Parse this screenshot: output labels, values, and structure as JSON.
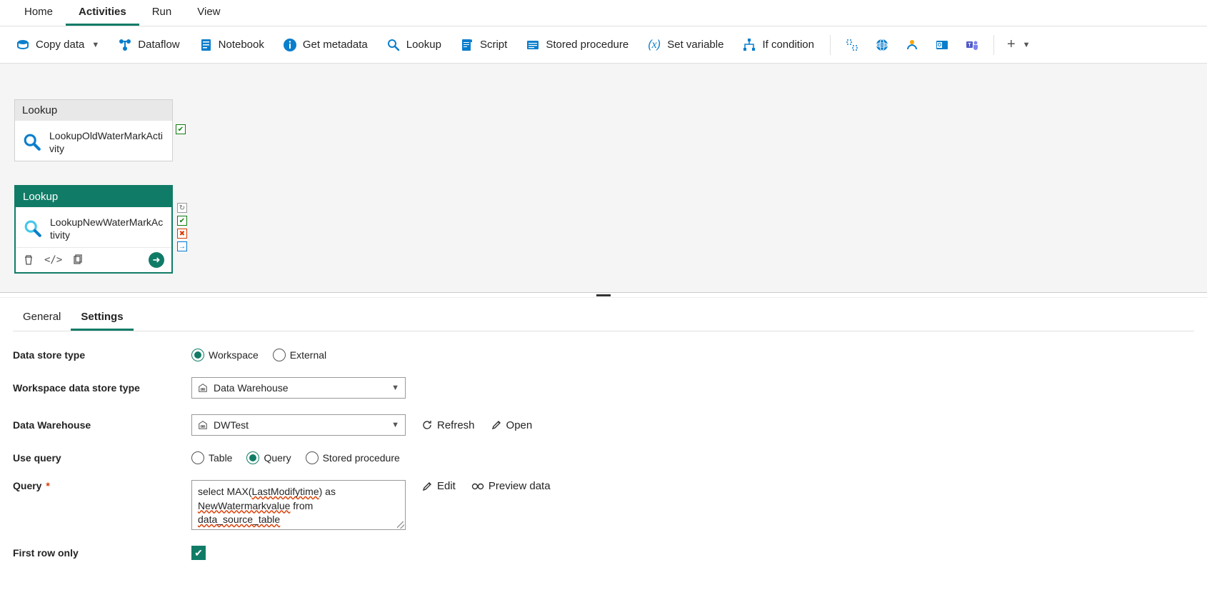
{
  "topTabs": {
    "home": "Home",
    "activities": "Activities",
    "run": "Run",
    "view": "View",
    "active": "activities"
  },
  "ribbon": {
    "copyData": "Copy data",
    "dataflow": "Dataflow",
    "notebook": "Notebook",
    "getMetadata": "Get metadata",
    "lookup": "Lookup",
    "script": "Script",
    "storedProcedure": "Stored procedure",
    "setVariable": "Set variable",
    "ifCondition": "If condition"
  },
  "canvas": {
    "activity1": {
      "type": "Lookup",
      "name": "LookupOldWaterMarkActivity"
    },
    "activity2": {
      "type": "Lookup",
      "name": "LookupNewWaterMarkActivity"
    }
  },
  "props": {
    "tabs": {
      "general": "General",
      "settings": "Settings",
      "active": "settings"
    },
    "labels": {
      "dataStoreType": "Data store type",
      "workspaceDataStoreType": "Workspace data store type",
      "dataWarehouse": "Data Warehouse",
      "useQuery": "Use query",
      "query": "Query",
      "firstRowOnly": "First row only"
    },
    "dataStoreType": {
      "workspace": "Workspace",
      "external": "External",
      "selected": "workspace"
    },
    "workspaceDataStoreType": {
      "value": "Data Warehouse"
    },
    "dataWarehouse": {
      "value": "DWTest",
      "refresh": "Refresh",
      "open": "Open"
    },
    "useQuery": {
      "table": "Table",
      "query": "Query",
      "storedProcedure": "Stored procedure",
      "selected": "query"
    },
    "query": {
      "text_line1_pre": "select MAX(",
      "text_line1_u": "LastModifytime",
      "text_line1_post": ") as",
      "text_line2_u": "NewWatermarkvalue",
      "text_line2_post": " from",
      "text_line3_u": "data_source_table",
      "edit": "Edit",
      "preview": "Preview data"
    },
    "firstRowOnly": {
      "checked": true
    }
  }
}
